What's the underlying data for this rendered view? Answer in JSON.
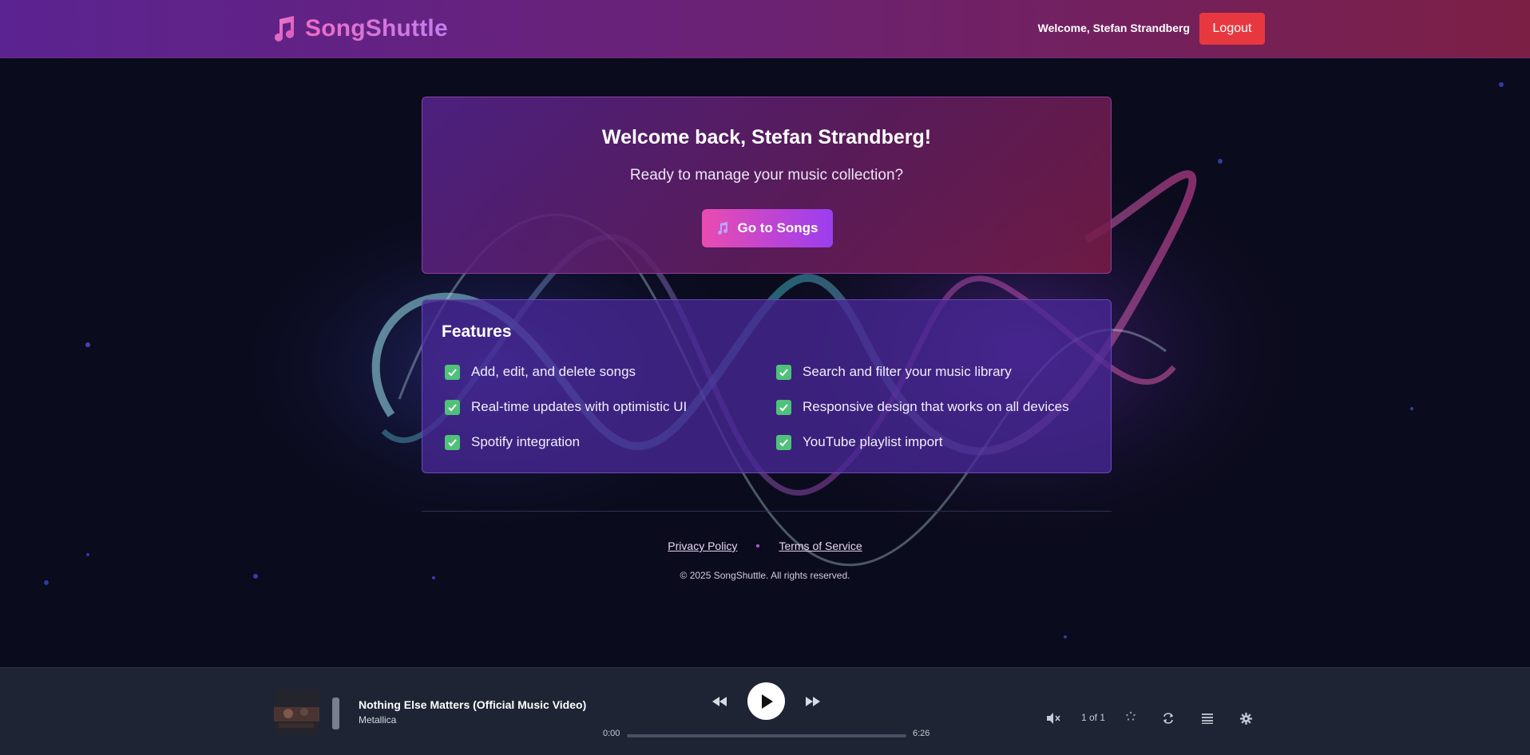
{
  "app": {
    "name": "SongShuttle"
  },
  "header": {
    "welcome_text": "Welcome, Stefan Strandberg",
    "logout_label": "Logout"
  },
  "welcome_card": {
    "title": "Welcome back, Stefan Strandberg!",
    "subtitle": "Ready to manage your music collection?",
    "button_label": "Go to Songs",
    "button_icon": "music-notes-icon"
  },
  "features": {
    "title": "Features",
    "items": [
      "Add, edit, and delete songs",
      "Search and filter your music library",
      "Real-time updates with optimistic UI",
      "Responsive design that works on all devices",
      "Spotify integration",
      "YouTube playlist import"
    ]
  },
  "footer": {
    "privacy_label": "Privacy Policy",
    "terms_label": "Terms of Service",
    "copyright": "© 2025 SongShuttle. All rights reserved."
  },
  "player": {
    "track_title": "Nothing Else Matters (Official Music Video)",
    "artist": "Metallica",
    "current_time": "0:00",
    "duration": "6:26",
    "progress": 0,
    "queue_position": "1 of 1",
    "controls": [
      "previous-icon",
      "play-icon",
      "next-icon",
      "mute-icon",
      "shuffle-icon",
      "repeat-icon",
      "queue-icon",
      "settings-icon"
    ]
  },
  "colors": {
    "header_start": "#5b2391",
    "header_end": "#7c1f45",
    "logout": "#e8383f",
    "accent_pink": "#e94cb0",
    "accent_purple": "#9b3ef0",
    "check_green": "#4fc17a",
    "player_bg": "#1e2434"
  }
}
